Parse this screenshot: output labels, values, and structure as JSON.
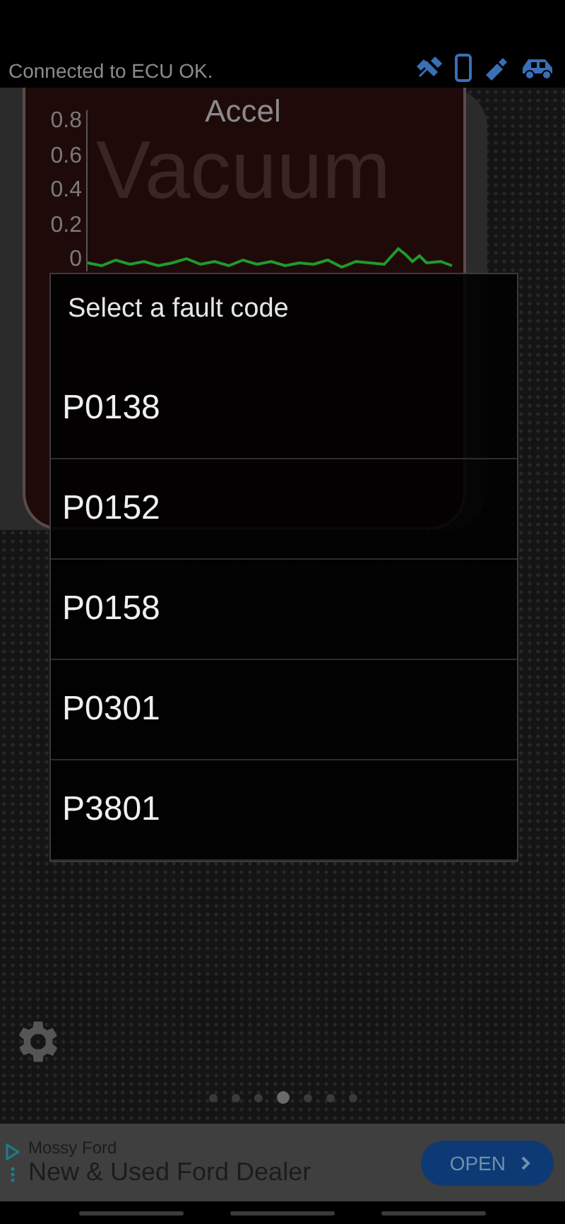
{
  "status": {
    "text": "Connected to ECU OK."
  },
  "gauge": {
    "title": "Accel",
    "watermark": "Vacuum",
    "y_ticks": [
      "0.8",
      "0.6",
      "0.4",
      "0.2",
      "0"
    ]
  },
  "dialog": {
    "title": "Select a fault code",
    "items": [
      {
        "code": "P0138"
      },
      {
        "code": "P0152"
      },
      {
        "code": "P0158"
      },
      {
        "code": "P0301"
      },
      {
        "code": "P3801"
      }
    ]
  },
  "pager": {
    "pages": [
      {
        "selected": false
      },
      {
        "selected": false
      },
      {
        "selected": false
      },
      {
        "selected": true
      },
      {
        "selected": false
      },
      {
        "selected": false
      },
      {
        "selected": false
      }
    ]
  },
  "ad": {
    "advertiser": "Mossy Ford",
    "headline": "New & Used Ford Dealer",
    "button": "OPEN"
  }
}
